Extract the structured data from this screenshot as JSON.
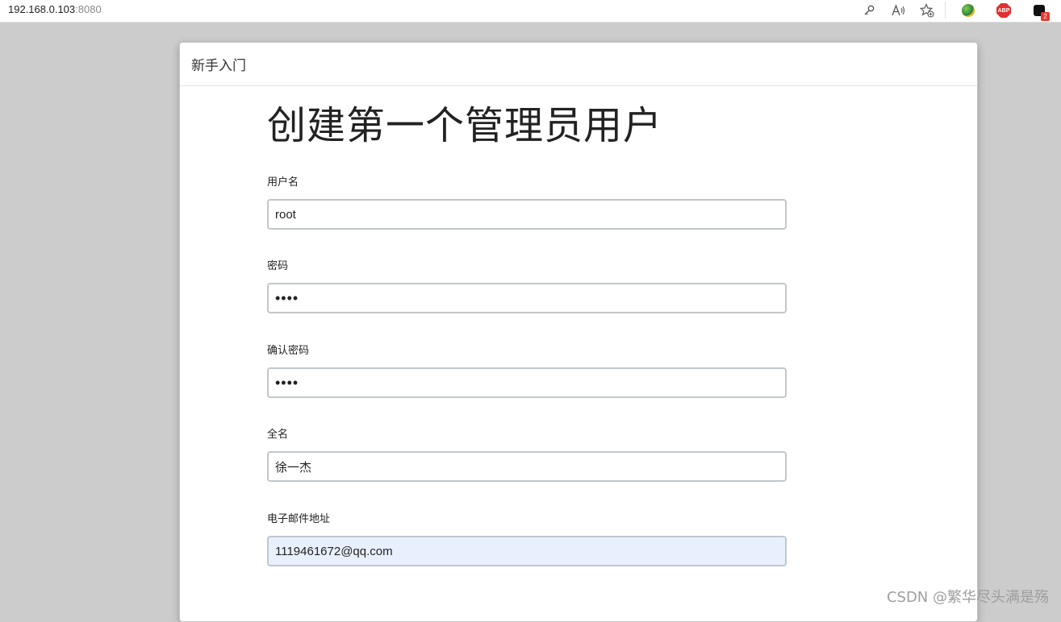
{
  "browser": {
    "address_host": "192.168.0.103",
    "address_port": ":8080",
    "extension_badge": "2",
    "abp_label": "ABP"
  },
  "dialog": {
    "title": "新手入门",
    "heading": "创建第一个管理员用户",
    "fields": [
      {
        "label": "用户名",
        "value": "root"
      },
      {
        "label": "密码",
        "value": "••••"
      },
      {
        "label": "确认密码",
        "value": "••••"
      },
      {
        "label": "全名",
        "value": "徐一杰"
      },
      {
        "label": "电子邮件地址",
        "value": "1119461672@qq.com"
      }
    ]
  },
  "watermark": "CSDN @繁华尽头满是殇",
  "colors": {
    "overlay_bg": "#cccccc",
    "autofill_bg": "#e8f0fe",
    "input_border": "#c1c7cd"
  }
}
